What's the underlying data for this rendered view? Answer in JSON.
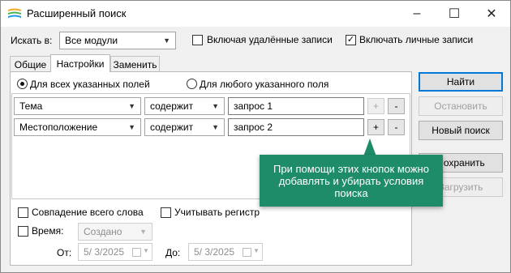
{
  "window": {
    "title": "Расширенный поиск",
    "controls": {
      "minimize": "–",
      "maximize": "☐",
      "close": "✕"
    }
  },
  "search_in": {
    "label": "Искать в:",
    "value": "Все модули",
    "include_deleted": {
      "label": "Включая удалённые записи",
      "checked": false
    },
    "include_personal": {
      "label": "Включать личные записи",
      "checked": true
    }
  },
  "tabs": [
    {
      "label": "Общие",
      "active": false
    },
    {
      "label": "Настройки",
      "active": true
    },
    {
      "label": "Заменить",
      "active": false
    }
  ],
  "match_mode": {
    "all_fields": {
      "label": "Для всех указанных полей",
      "checked": true
    },
    "any_field": {
      "label": "Для любого указанного поля",
      "checked": false
    }
  },
  "conditions": [
    {
      "field": "Тема",
      "operator": "содержит",
      "value": "запрос 1",
      "add_enabled": false,
      "remove_label": "-",
      "add_label": "+"
    },
    {
      "field": "Местоположение",
      "operator": "содержит",
      "value": "запрос 2",
      "add_enabled": true,
      "remove_label": "-",
      "add_label": "+"
    }
  ],
  "options": {
    "whole_word": {
      "label": "Совпадение всего слова",
      "checked": false
    },
    "match_case": {
      "label": "Учитывать регистр",
      "checked": false
    },
    "time": {
      "label": "Время:",
      "checked": false,
      "value": "Создано"
    },
    "from": {
      "label": "От:",
      "value": "5/ 3/2025"
    },
    "to": {
      "label": "До:",
      "value": "5/ 3/2025"
    }
  },
  "buttons": {
    "find": "Найти",
    "stop": "Остановить",
    "new_search": "Новый поиск",
    "save": "Сохранить",
    "load": "Загрузить"
  },
  "callout": {
    "text": "При помощи этих кнопок можно добавлять и убирать условия поиска"
  },
  "colors": {
    "accent": "#0078d7",
    "callout": "#1f8c69"
  }
}
